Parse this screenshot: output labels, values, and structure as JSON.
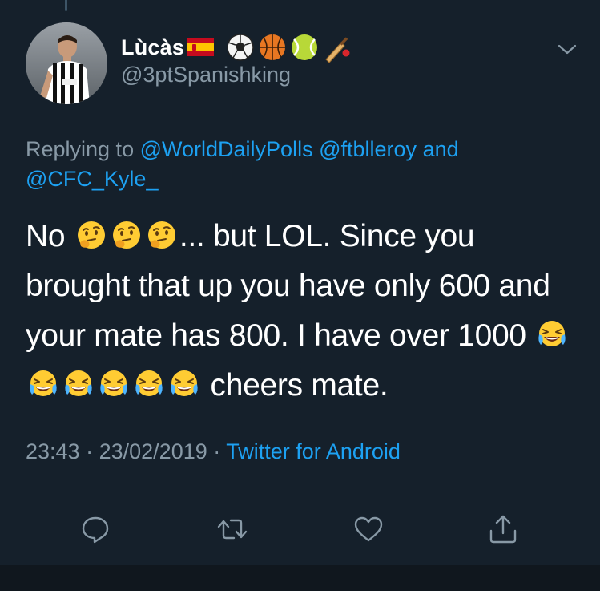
{
  "tweet": {
    "display_name": "Lùcàs",
    "handle": "@3ptSpanishking",
    "name_icons": [
      "spain-flag-icon",
      "soccer-ball-icon",
      "basketball-icon",
      "tennis-ball-icon",
      "cricket-bat-icon"
    ],
    "reply_prefix": "Replying to",
    "mentions": [
      "@WorldDailyPolls",
      "@ftblleroy",
      "@CFC_Kyle_"
    ],
    "reply_and": "and",
    "text_segments": {
      "part1": "No",
      "thinking_emoji_count": 3,
      "part2": "... but LOL. Since you brought that up you have only 600 and your mate has 800. I have over 1000",
      "laughing_emoji_count": 6,
      "part3": "cheers mate."
    },
    "time": "23:43",
    "separator": "·",
    "date": "23/02/2019",
    "source": "Twitter for Android"
  },
  "actions": [
    "reply-icon",
    "retweet-icon",
    "like-icon",
    "share-icon"
  ],
  "colors": {
    "background": "#15202b",
    "text": "#ffffff",
    "secondary": "#8899a6",
    "accent": "#1da1f2",
    "divider": "#38444d"
  }
}
